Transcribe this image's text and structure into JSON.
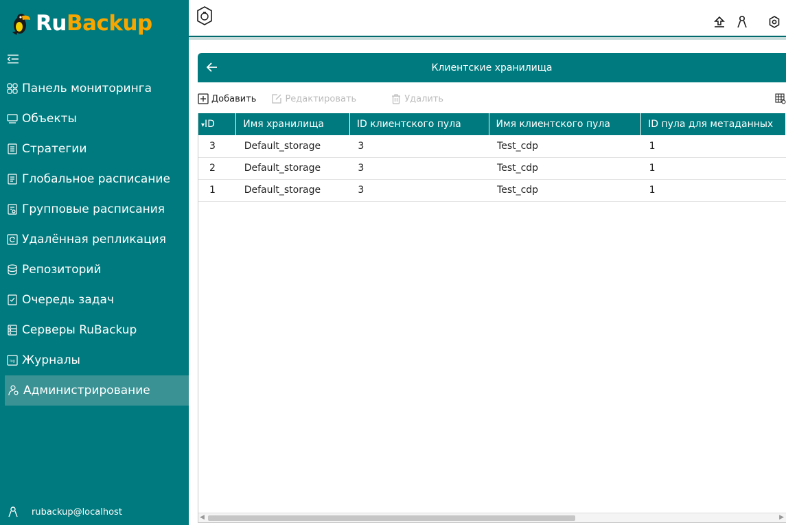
{
  "app": {
    "logo_ru": "Ru",
    "logo_backup": "Backup",
    "brand_color": "#007a7e",
    "accent_color": "#f7a600"
  },
  "sidebar": {
    "collapse_icon": "collapse-sidebar-icon",
    "items": [
      {
        "label": "Панель мониторинга",
        "icon": "dashboard-icon"
      },
      {
        "label": "Объекты",
        "icon": "monitor-icon"
      },
      {
        "label": "Стратегии",
        "icon": "strategy-icon"
      },
      {
        "label": "Глобальное расписание",
        "icon": "schedule-icon"
      },
      {
        "label": "Групповые расписания",
        "icon": "group-schedule-icon"
      },
      {
        "label": "Удалённая репликация",
        "icon": "replication-icon"
      },
      {
        "label": "Репозиторий",
        "icon": "database-icon"
      },
      {
        "label": "Очередь задач",
        "icon": "task-queue-icon"
      },
      {
        "label": "Серверы RuBackup",
        "icon": "server-icon"
      },
      {
        "label": "Журналы",
        "icon": "log-icon"
      },
      {
        "label": "Администрирование",
        "icon": "admin-icon",
        "active": true
      }
    ],
    "user": "rubackup@localhost"
  },
  "topbar": {
    "icons": [
      "app-badge-icon",
      "upload-icon",
      "user-icon",
      "settings-icon"
    ]
  },
  "panel": {
    "title": "Клиентские хранилища",
    "back_icon": "back-arrow-icon"
  },
  "toolbar": {
    "add_label": "Добавить",
    "edit_label": "Редактировать",
    "delete_label": "Удалить"
  },
  "table": {
    "columns": [
      "ID",
      "Имя хранилища",
      "ID клиентского пула",
      "Имя клиентского пула",
      "ID пула для метаданных"
    ],
    "sort_indicator": "▾",
    "rows": [
      [
        "3",
        "Default_storage",
        "3",
        "Test_cdp",
        "1"
      ],
      [
        "2",
        "Default_storage",
        "3",
        "Test_cdp",
        "1"
      ],
      [
        "1",
        "Default_storage",
        "3",
        "Test_cdp",
        "1"
      ]
    ]
  }
}
